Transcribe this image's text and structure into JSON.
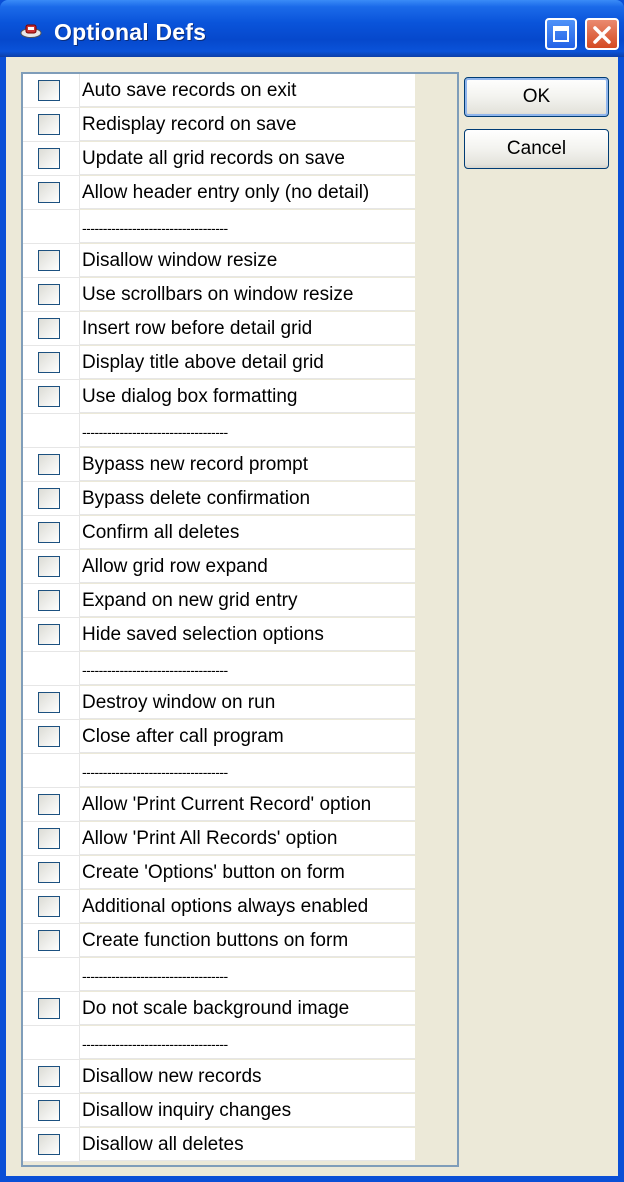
{
  "window": {
    "title": "Optional Defs"
  },
  "buttons": {
    "ok": "OK",
    "cancel": "Cancel"
  },
  "options": [
    {
      "label": "Auto save records on exit",
      "checked": false
    },
    {
      "label": "Redisplay record on save",
      "checked": false
    },
    {
      "label": "Update all grid records on save",
      "checked": false
    },
    {
      "label": "Allow header entry only (no detail)",
      "checked": false
    },
    {
      "label": "-----------------------------------",
      "separator": true
    },
    {
      "label": "Disallow window resize",
      "checked": false
    },
    {
      "label": "Use scrollbars on window resize",
      "checked": false
    },
    {
      "label": "Insert row before detail grid",
      "checked": false
    },
    {
      "label": "Display title above detail grid",
      "checked": false
    },
    {
      "label": "Use dialog box formatting",
      "checked": false
    },
    {
      "label": "-----------------------------------",
      "separator": true
    },
    {
      "label": "Bypass new record prompt",
      "checked": false
    },
    {
      "label": "Bypass delete confirmation",
      "checked": false
    },
    {
      "label": "Confirm all deletes",
      "checked": false
    },
    {
      "label": "Allow grid row expand",
      "checked": false
    },
    {
      "label": "Expand on new grid entry",
      "checked": false
    },
    {
      "label": "Hide saved selection options",
      "checked": false
    },
    {
      "label": "-----------------------------------",
      "separator": true
    },
    {
      "label": "Destroy window on run",
      "checked": false
    },
    {
      "label": "Close after call program",
      "checked": false
    },
    {
      "label": "-----------------------------------",
      "separator": true
    },
    {
      "label": "Allow 'Print Current Record' option",
      "checked": false
    },
    {
      "label": "Allow 'Print All Records' option",
      "checked": false
    },
    {
      "label": "Create 'Options' button on form",
      "checked": false
    },
    {
      "label": "Additional options always enabled",
      "checked": false
    },
    {
      "label": "Create function buttons on form",
      "checked": false
    },
    {
      "label": "-----------------------------------",
      "separator": true
    },
    {
      "label": "Do not scale background image",
      "checked": false
    },
    {
      "label": "-----------------------------------",
      "separator": true
    },
    {
      "label": "Disallow new records",
      "checked": false
    },
    {
      "label": "Disallow inquiry changes",
      "checked": false
    },
    {
      "label": "Disallow all deletes",
      "checked": false
    }
  ]
}
